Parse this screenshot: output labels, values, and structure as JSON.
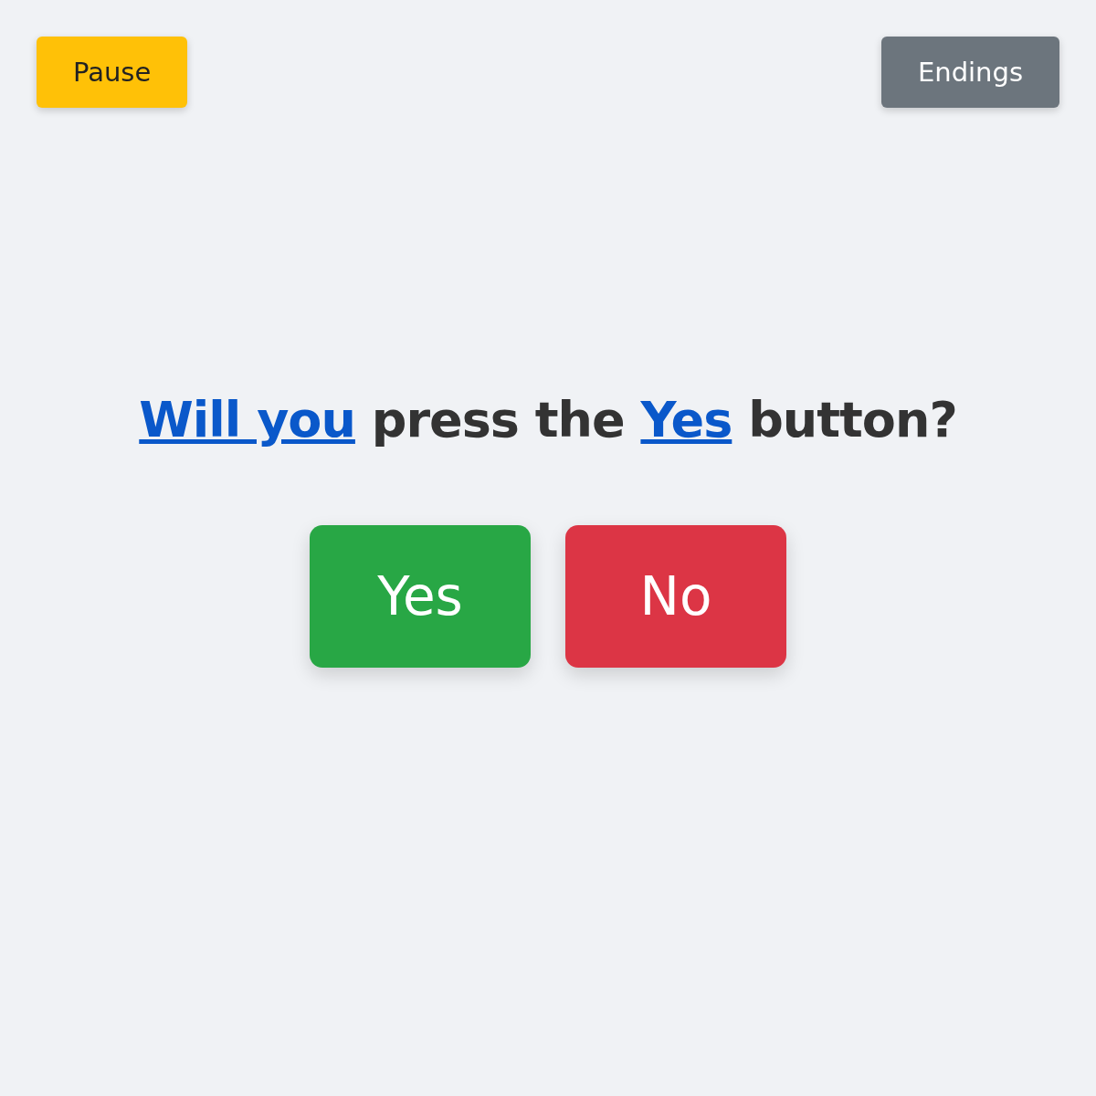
{
  "top_bar": {
    "pause_button": "Pause",
    "endings_button": "Endings"
  },
  "question": [
    {
      "kind": "link",
      "text": "Will you"
    },
    {
      "kind": "plain",
      "text": " press the "
    },
    {
      "kind": "link",
      "text": "Yes"
    },
    {
      "kind": "plain",
      "text": " button?"
    }
  ],
  "answers": [
    {
      "label": "Yes",
      "color": "#28a745"
    },
    {
      "label": "No",
      "color": "#dc3545"
    }
  ]
}
